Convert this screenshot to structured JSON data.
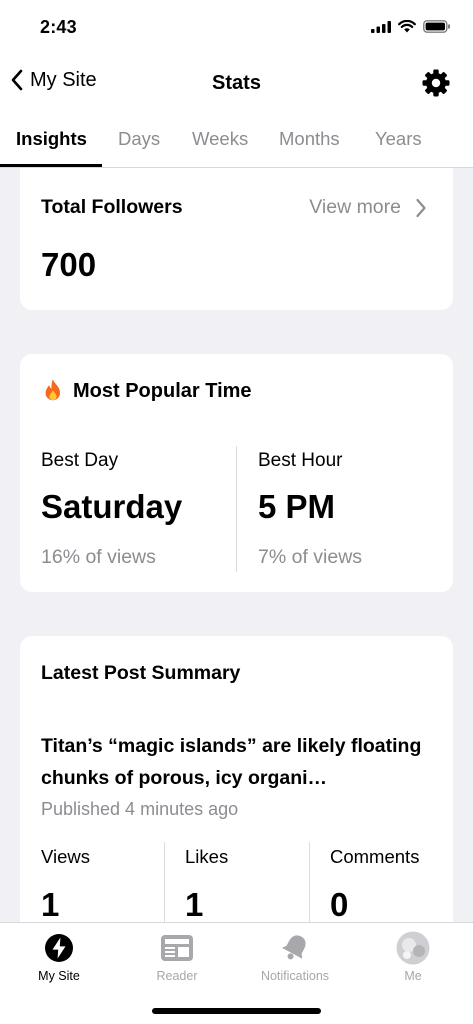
{
  "status": {
    "time": "2:43"
  },
  "nav": {
    "back_label": "My Site",
    "title": "Stats"
  },
  "tabs": [
    {
      "label": "Insights",
      "active": true
    },
    {
      "label": "Days"
    },
    {
      "label": "Weeks"
    },
    {
      "label": "Months"
    },
    {
      "label": "Years"
    }
  ],
  "followers": {
    "title": "Total Followers",
    "view_more": "View more",
    "count": "700"
  },
  "popular": {
    "title": "Most Popular Time",
    "best_day_label": "Best Day",
    "best_day_value": "Saturday",
    "best_day_sub": "16% of views",
    "best_hour_label": "Best Hour",
    "best_hour_value": "5 PM",
    "best_hour_sub": "7% of views"
  },
  "latest": {
    "title": "Latest Post Summary",
    "post_title": "Titan’s “magic islands” are likely floating chunks of porous, icy organi…",
    "published": "Published 4 minutes ago",
    "stats": [
      {
        "label": "Views",
        "value": "1"
      },
      {
        "label": "Likes",
        "value": "1"
      },
      {
        "label": "Comments",
        "value": "0"
      }
    ]
  },
  "tabbar": [
    {
      "label": "My Site",
      "icon": "jetpack-icon",
      "active": true
    },
    {
      "label": "Reader",
      "icon": "reader-icon"
    },
    {
      "label": "Notifications",
      "icon": "bell-icon"
    },
    {
      "label": "Me",
      "icon": "avatar"
    }
  ],
  "colors": {
    "accent": "#000000",
    "muted": "#8c8c92",
    "background": "#f1f0f5"
  }
}
